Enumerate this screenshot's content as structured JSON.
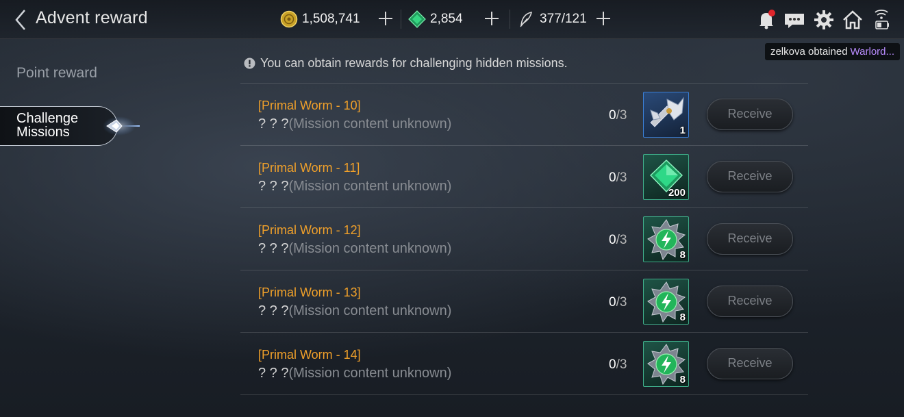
{
  "header": {
    "title": "Advent reward",
    "currencies": {
      "gold": {
        "value": "1,508,741",
        "icon": "gold-coin-icon"
      },
      "gems": {
        "value": "2,854",
        "icon": "green-gem-icon"
      },
      "stamina": {
        "value": "377/121",
        "icon": "feather-icon"
      }
    },
    "icons": [
      "bell-icon",
      "chat-icon",
      "gear-icon",
      "home-icon",
      "wifi-battery-icon"
    ]
  },
  "toast": {
    "user": "zelkova",
    "verb": "obtained",
    "item": "Warlord..."
  },
  "nav": {
    "point_reward": "Point reward",
    "challenge_missions": "Challenge Missions"
  },
  "info": {
    "text": "You can obtain rewards for challenging hidden missions."
  },
  "missions": [
    {
      "title": "[Primal Worm - 10]",
      "question": "? ? ?",
      "desc": "(Mission content unknown)",
      "progress_num": "0",
      "progress_den": "/3",
      "reward_icon": "winged-axe-icon",
      "reward_qty": "1",
      "frame": "blue",
      "button": "Receive"
    },
    {
      "title": "[Primal Worm - 11]",
      "question": "? ? ?",
      "desc": "(Mission content unknown)",
      "progress_num": "0",
      "progress_den": "/3",
      "reward_icon": "green-gem-icon",
      "reward_qty": "200",
      "frame": "green",
      "button": "Receive"
    },
    {
      "title": "[Primal Worm - 12]",
      "question": "? ? ?",
      "desc": "(Mission content unknown)",
      "progress_num": "0",
      "progress_den": "/3",
      "reward_icon": "lightning-orb-icon",
      "reward_qty": "8",
      "frame": "green",
      "button": "Receive"
    },
    {
      "title": "[Primal Worm - 13]",
      "question": "? ? ?",
      "desc": "(Mission content unknown)",
      "progress_num": "0",
      "progress_den": "/3",
      "reward_icon": "lightning-orb-icon",
      "reward_qty": "8",
      "frame": "green",
      "button": "Receive"
    },
    {
      "title": "[Primal Worm - 14]",
      "question": "? ? ?",
      "desc": "(Mission content unknown)",
      "progress_num": "0",
      "progress_den": "/3",
      "reward_icon": "lightning-orb-icon",
      "reward_qty": "8",
      "frame": "green",
      "button": "Receive"
    }
  ],
  "colors": {
    "mission_title": "#f0a02a",
    "toast_item": "#b98cff",
    "gem_green": "#2ecf7a",
    "frame_blue": "#3a7fd6",
    "frame_green": "#3fae8a"
  }
}
